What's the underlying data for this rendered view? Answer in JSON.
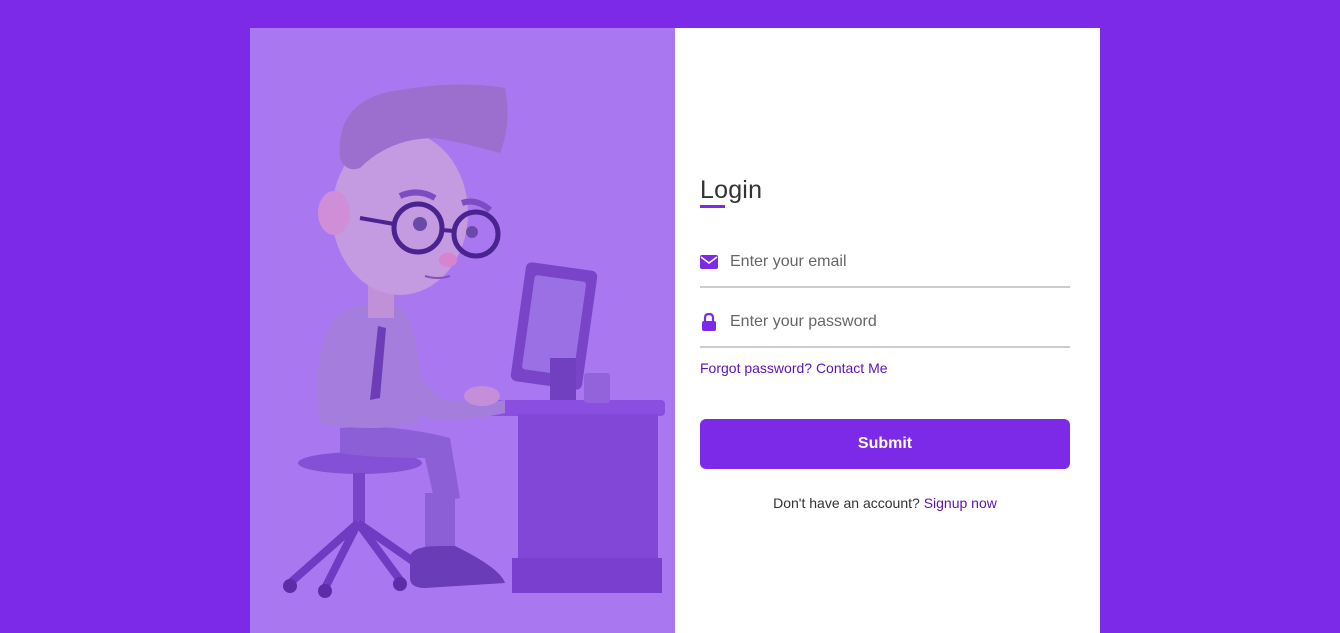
{
  "login": {
    "title": "Login",
    "email_placeholder": "Enter your email",
    "password_placeholder": "Enter your password",
    "forgot_text": "Forgot password? Contact Me",
    "submit_label": "Submit",
    "signup_prompt": "Don't have an account?",
    "signup_link": "Signup now"
  },
  "icons": {
    "email": "envelope-icon",
    "password": "lock-icon"
  },
  "colors": {
    "background": "#7d2ae8",
    "accent": "#7d2ae8",
    "link": "#5b13b9",
    "cover": "#a978f0"
  }
}
